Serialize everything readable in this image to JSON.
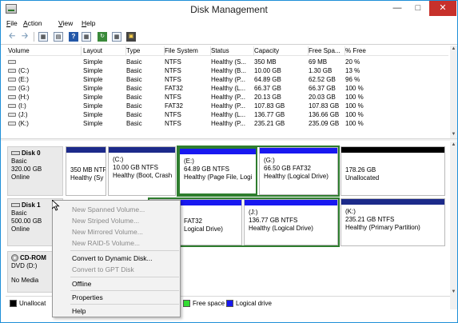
{
  "window": {
    "title": "Disk Management"
  },
  "menubar": [
    {
      "label": "File",
      "accel": "F",
      "rest": "ile"
    },
    {
      "label": "Action",
      "accel": "A",
      "rest": "ction"
    },
    {
      "label": "View",
      "accel": "V",
      "rest": "iew"
    },
    {
      "label": "Help",
      "accel": "H",
      "rest": "elp"
    }
  ],
  "toolbar": {
    "icons": [
      "back-arrow-icon",
      "forward-arrow-icon",
      "console-tree-icon",
      "properties-icon",
      "help-icon",
      "rescan-icon",
      "action-icon"
    ]
  },
  "volumes": {
    "columns": [
      "Volume",
      "Layout",
      "Type",
      "File System",
      "Status",
      "Capacity",
      "Free Spa...",
      "% Free"
    ],
    "rows": [
      [
        "",
        "Simple",
        "Basic",
        "NTFS",
        "Healthy (S...",
        "350 MB",
        "69 MB",
        "20 %"
      ],
      [
        "(C:)",
        "Simple",
        "Basic",
        "NTFS",
        "Healthy (B...",
        "10.00 GB",
        "1.30 GB",
        "13 %"
      ],
      [
        "(E:)",
        "Simple",
        "Basic",
        "NTFS",
        "Healthy (P...",
        "64.89 GB",
        "62.52 GB",
        "96 %"
      ],
      [
        "(G:)",
        "Simple",
        "Basic",
        "FAT32",
        "Healthy (L...",
        "66.37 GB",
        "66.37 GB",
        "100 %"
      ],
      [
        "(H:)",
        "Simple",
        "Basic",
        "NTFS",
        "Healthy (P...",
        "20.13 GB",
        "20.03 GB",
        "100 %"
      ],
      [
        "(I:)",
        "Simple",
        "Basic",
        "FAT32",
        "Healthy (P...",
        "107.83 GB",
        "107.83 GB",
        "100 %"
      ],
      [
        "(J:)",
        "Simple",
        "Basic",
        "NTFS",
        "Healthy (L...",
        "136.77 GB",
        "136.66 GB",
        "100 %"
      ],
      [
        "(K:)",
        "Simple",
        "Basic",
        "NTFS",
        "Healthy (P...",
        "235.21 GB",
        "235.09 GB",
        "100 %"
      ]
    ]
  },
  "disks": {
    "disk0": {
      "name": "Disk 0",
      "type": "Basic",
      "size": "320.00 GB",
      "status": "Online",
      "partitions": [
        {
          "title": "",
          "line1": "350 MB NTF",
          "line2": "Healthy (Sy"
        },
        {
          "title": "(C:)",
          "line1": "10.00 GB NTFS",
          "line2": "Healthy (Boot, Crash"
        },
        {
          "title": "(E:)",
          "line1": "64.89 GB NTFS",
          "line2": "Healthy (Page File, Logi"
        },
        {
          "title": "(G:)",
          "line1": "66.50 GB FAT32",
          "line2": "Healthy (Logical Drive)"
        },
        {
          "title": "",
          "line1": "178.26 GB",
          "line2": "Unallocated"
        }
      ]
    },
    "disk1": {
      "name": "Disk 1",
      "type": "Basic",
      "size": "500.00 GB",
      "status": "Online",
      "partitions": [
        {
          "title": "",
          "line1": "FAT32",
          "line2": "Logical Drive)"
        },
        {
          "title": "(J:)",
          "line1": "136.77 GB NTFS",
          "line2": "Healthy (Logical Drive)"
        },
        {
          "title": "(K:)",
          "line1": "235.21 GB NTFS",
          "line2": "Healthy (Primary Partition)"
        }
      ]
    },
    "cdrom": {
      "name": "CD-ROM",
      "type": "DVD (D:)",
      "status": "No Media"
    }
  },
  "legend": [
    {
      "label": "Unallocat",
      "color": "#000000"
    },
    {
      "label": "Free space",
      "color": "#33dd33"
    },
    {
      "label": "Logical drive",
      "color": "#1818f0"
    }
  ],
  "context_menu": {
    "items": [
      {
        "label": "New Spanned Volume...",
        "enabled": false
      },
      {
        "label": "New Striped Volume...",
        "enabled": false
      },
      {
        "label": "New Mirrored Volume...",
        "enabled": false
      },
      {
        "label": "New RAID-5 Volume...",
        "enabled": false
      },
      {
        "label": "Convert to Dynamic Disk...",
        "enabled": true
      },
      {
        "label": "Convert to GPT Disk",
        "enabled": false
      },
      {
        "label": "Offline",
        "enabled": true
      },
      {
        "label": "Properties",
        "enabled": true
      },
      {
        "label": "Help",
        "enabled": true
      }
    ]
  }
}
